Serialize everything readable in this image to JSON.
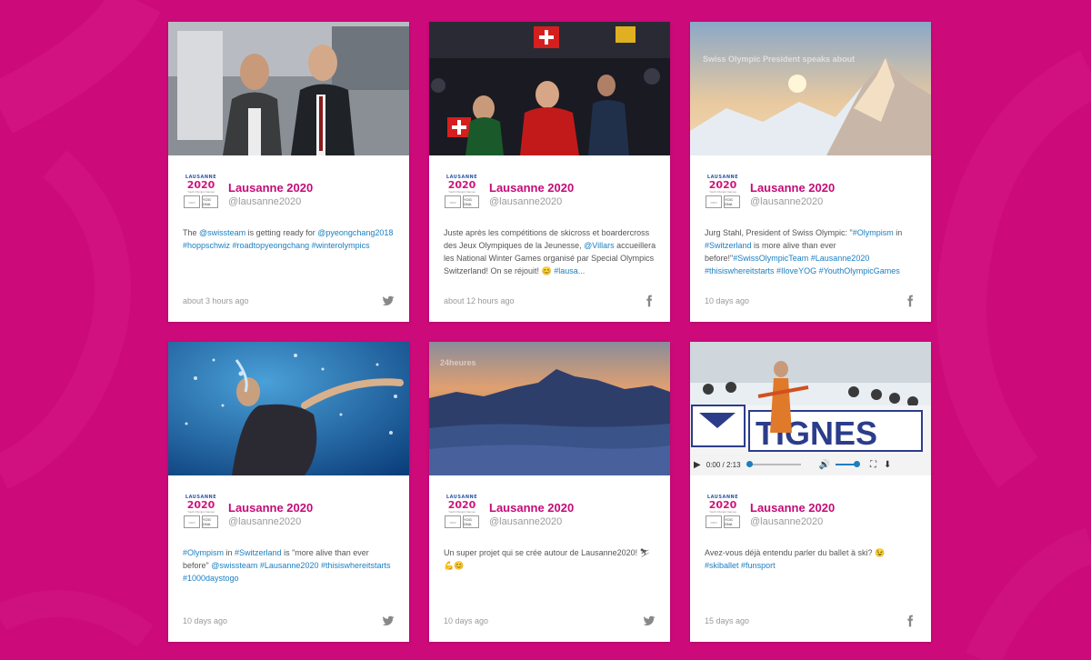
{
  "brand": {
    "background": "#cc0a7a",
    "name_color": "#c40b77",
    "link_color": "#1a7fc1"
  },
  "logo": {
    "line1": "LAUSANNE",
    "line2": "2020",
    "line3": "Youth Olympic Games",
    "box1": "○○○",
    "box2": "YOG DNA"
  },
  "posts": [
    {
      "author": "Lausanne 2020",
      "handle": "@lausanne2020",
      "text_parts": [
        {
          "t": "The ",
          "link": false
        },
        {
          "t": "@swissteam",
          "link": true
        },
        {
          "t": " is getting ready for ",
          "link": false
        },
        {
          "t": "@pyeongchang2018",
          "link": true
        },
        {
          "t": " ",
          "link": false
        },
        {
          "t": "#hoppschwiz",
          "link": true
        },
        {
          "t": " ",
          "link": false
        },
        {
          "t": "#roadtopyeongchang",
          "link": true
        },
        {
          "t": " ",
          "link": false
        },
        {
          "t": "#winterolympics",
          "link": true
        }
      ],
      "time": "about 3 hours ago",
      "network_icon": "twitter-icon",
      "media": "photo-handshake"
    },
    {
      "author": "Lausanne 2020",
      "handle": "@lausanne2020",
      "text_parts": [
        {
          "t": "Juste après les compétitions de skicross et boardercross des Jeux Olympiques de la Jeunesse, ",
          "link": false
        },
        {
          "t": "@Villars",
          "link": true
        },
        {
          "t": " accueillera les National Winter Games organisé par Special Olympics Switzerland! On se réjouit! 😊 ",
          "link": false
        },
        {
          "t": "#lausa...",
          "link": true
        }
      ],
      "time": "about 12 hours ago",
      "network_icon": "facebook-icon",
      "media": "photo-crowd-flags"
    },
    {
      "author": "Lausanne 2020",
      "handle": "@lausanne2020",
      "text_parts": [
        {
          "t": "Jurg Stahl, President of Swiss Olympic: \"",
          "link": false
        },
        {
          "t": "#Olympism",
          "link": true
        },
        {
          "t": " in ",
          "link": false
        },
        {
          "t": "#Switzerland",
          "link": true
        },
        {
          "t": " is more alive than ever before!\"",
          "link": false
        },
        {
          "t": "#SwissOlympicTeam",
          "link": true
        },
        {
          "t": " ",
          "link": false
        },
        {
          "t": "#Lausanne2020",
          "link": true
        },
        {
          "t": " ",
          "link": false
        },
        {
          "t": "#thisiswhereitstarts",
          "link": true
        },
        {
          "t": " ",
          "link": false
        },
        {
          "t": "#IloveYOG",
          "link": true
        },
        {
          "t": " ",
          "link": false
        },
        {
          "t": "#YouthOlympicGames",
          "link": true
        }
      ],
      "time": "10 days ago",
      "network_icon": "facebook-icon",
      "media": "photo-mountain-sunrise",
      "media_caption": "Swiss Olympic President speaks about"
    },
    {
      "author": "Lausanne 2020",
      "handle": "@lausanne2020",
      "text_parts": [
        {
          "t": "#Olympism",
          "link": true
        },
        {
          "t": " in ",
          "link": false
        },
        {
          "t": "#Switzerland",
          "link": true
        },
        {
          "t": " is \"more alive than ever before\" ",
          "link": false
        },
        {
          "t": "@swissteam",
          "link": true
        },
        {
          "t": " ",
          "link": false
        },
        {
          "t": "#Lausanne2020",
          "link": true
        },
        {
          "t": " ",
          "link": false
        },
        {
          "t": "#thisiswhereitstarts",
          "link": true
        },
        {
          "t": " ",
          "link": false
        },
        {
          "t": "#1000daystogo",
          "link": true
        }
      ],
      "time": "10 days ago",
      "network_icon": "twitter-icon",
      "media": "photo-swimmer"
    },
    {
      "author": "Lausanne 2020",
      "handle": "@lausanne2020",
      "text_parts": [
        {
          "t": "Un super projet qui se crée autour de Lausanne2020! ⛷ 💪😊",
          "link": false
        }
      ],
      "time": "10 days ago",
      "network_icon": "twitter-icon",
      "media": "photo-mountains-clouds",
      "media_caption": "24heures"
    },
    {
      "author": "Lausanne 2020",
      "handle": "@lausanne2020",
      "text_parts": [
        {
          "t": "Avez-vous déjà entendu parler du ballet à ski? 😉",
          "link": false
        },
        {
          "t": "#skiballet",
          "link": true
        },
        {
          "t": " ",
          "link": false
        },
        {
          "t": "#funsport",
          "link": true
        }
      ],
      "time": "15 days ago",
      "network_icon": "facebook-icon",
      "media": "video-ski-ballet",
      "video": {
        "time": "0:00 / 2:13",
        "banner": "TIGNES"
      }
    }
  ]
}
